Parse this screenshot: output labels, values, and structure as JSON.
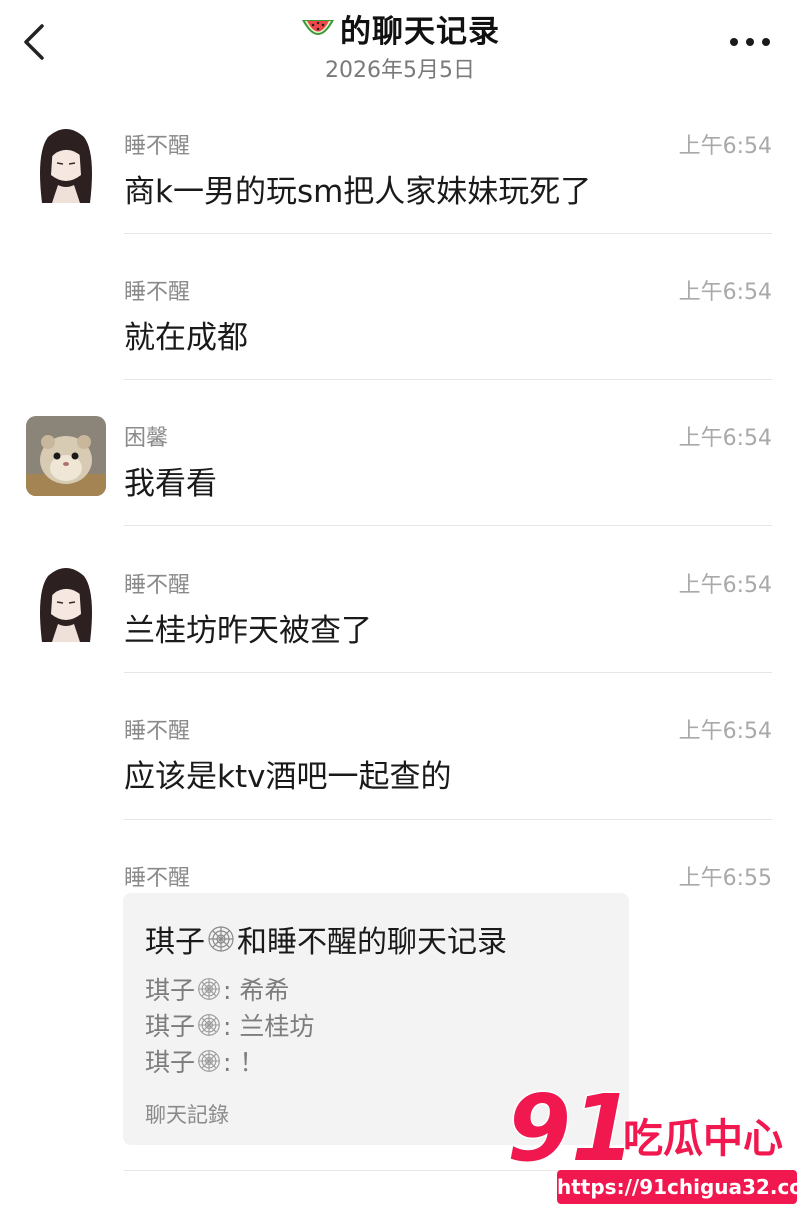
{
  "header": {
    "title": "的聊天记录",
    "date": "2026年5月5日",
    "title_icon": "watermelon-icon"
  },
  "messages": [
    {
      "sender": "睡不醒",
      "time": "上午6:54",
      "text": "商k一男的玩sm把人家妹妹玩死了",
      "avatar": "girl-avatar"
    },
    {
      "sender": "睡不醒",
      "time": "上午6:54",
      "text": "就在成都"
    },
    {
      "sender": "困馨",
      "time": "上午6:54",
      "text": "我看看",
      "avatar": "hamster-avatar"
    },
    {
      "sender": "睡不醒",
      "time": "上午6:54",
      "text": "兰桂坊昨天被查了",
      "avatar": "girl-avatar"
    },
    {
      "sender": "睡不醒",
      "time": "上午6:54",
      "text": "应该是ktv酒吧一起查的"
    },
    {
      "sender": "睡不醒",
      "time": "上午6:55"
    }
  ],
  "card": {
    "title_a": "琪子",
    "title_b": "和睡不醒的聊天记录",
    "lines": [
      {
        "name": "琪子",
        "text": ": 希希"
      },
      {
        "name": "琪子",
        "text": ": 兰桂坊"
      },
      {
        "name": "琪子",
        "text": ": ！"
      }
    ],
    "footer": "聊天記錄"
  },
  "watermark": {
    "number": "91",
    "brand": "吃瓜中心",
    "url": "https://91chigua32.com"
  },
  "colors": {
    "background": "#ffffff",
    "divider": "#e6e6e6",
    "card_bg": "#f3f3f3",
    "watermark": "#f0184f"
  }
}
